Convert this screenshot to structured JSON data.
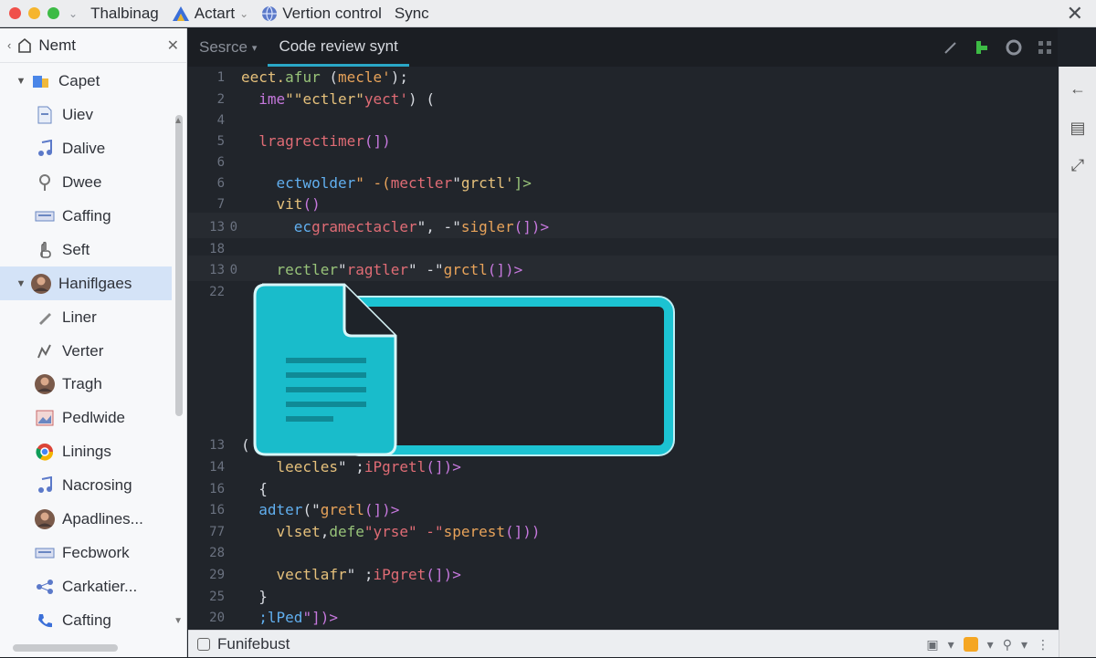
{
  "titlebar": {
    "items": [
      {
        "label": "Thalbinag",
        "icon": "chevron-icon"
      },
      {
        "label": "Actart",
        "icon": "triangle-logo-icon"
      },
      {
        "label": "Vertion control",
        "icon": "globe-icon"
      },
      {
        "label": "Sync",
        "icon": ""
      }
    ]
  },
  "sidebar": {
    "title": "Nemt",
    "items": [
      {
        "label": "Capet",
        "icon": "folder-icon",
        "expanded": true,
        "level": 1
      },
      {
        "label": "Uiev",
        "icon": "document-icon",
        "level": 2
      },
      {
        "label": "Dalive",
        "icon": "music-note-icon",
        "level": 2
      },
      {
        "label": "Dwee",
        "icon": "pin-icon",
        "level": 2
      },
      {
        "label": "Caffing",
        "icon": "keyboard-icon",
        "level": 2
      },
      {
        "label": "Seft",
        "icon": "hand-icon",
        "level": 2
      },
      {
        "label": "Haniflgaes",
        "icon": "avatar-icon",
        "expanded": true,
        "level": 1,
        "selected": true
      },
      {
        "label": "Liner",
        "icon": "pencil-icon",
        "level": 2
      },
      {
        "label": "Verter",
        "icon": "chart-icon",
        "level": 2
      },
      {
        "label": "Tragh",
        "icon": "avatar-icon",
        "level": 2
      },
      {
        "label": "Pedlwide",
        "icon": "image-icon",
        "level": 2
      },
      {
        "label": "Linings",
        "icon": "chrome-icon",
        "level": 2
      },
      {
        "label": "Nacrosing",
        "icon": "music-note-icon",
        "level": 2
      },
      {
        "label": "Apadlines...",
        "icon": "avatar-icon",
        "level": 2
      },
      {
        "label": "Fecbwork",
        "icon": "keyboard-icon",
        "level": 2
      },
      {
        "label": "Carkatier...",
        "icon": "network-icon",
        "level": 2
      },
      {
        "label": "Cafting",
        "icon": "phone-icon",
        "level": 2
      }
    ]
  },
  "editor": {
    "tabs": [
      {
        "label": "Sesrce",
        "active": false,
        "dropdown": true
      },
      {
        "label": "Code review synt",
        "active": true
      }
    ],
    "lines": [
      {
        "num": "1",
        "segments": [
          {
            "t": "eect.",
            "c": "c-yel"
          },
          {
            "t": "afur",
            "c": "c-grn"
          },
          {
            "t": " (",
            "c": "c-wht"
          },
          {
            "t": "mecle'",
            "c": "c-org"
          },
          {
            "t": ");",
            "c": "c-wht"
          }
        ]
      },
      {
        "num": "2",
        "segments": [
          {
            "t": "  ime",
            "c": "c-pur"
          },
          {
            "t": "\"\"ectler\"",
            "c": "c-yel"
          },
          {
            "t": "yect'",
            "c": "c-red"
          },
          {
            "t": ") (",
            "c": "c-wht"
          }
        ]
      },
      {
        "num": "4",
        "segments": []
      },
      {
        "num": "5",
        "segments": [
          {
            "t": "  lragrectimer",
            "c": "c-red"
          },
          {
            "t": "(])",
            "c": "c-pur"
          }
        ]
      },
      {
        "num": "6",
        "segments": []
      },
      {
        "num": "6",
        "segments": [
          {
            "t": "    ectwolder",
            "c": "c-blu"
          },
          {
            "t": "\" -(",
            "c": "c-org"
          },
          {
            "t": "mectler",
            "c": "c-red"
          },
          {
            "t": "\"",
            "c": "c-wht"
          },
          {
            "t": "grctl'",
            "c": "c-yel"
          },
          {
            "t": "]>",
            "c": "c-grn"
          }
        ]
      },
      {
        "num": "7",
        "segments": [
          {
            "t": "    vit",
            "c": "c-yel"
          },
          {
            "t": "()",
            "c": "c-pur"
          }
        ]
      },
      {
        "num": "13",
        "segments": [
          {
            "t": "      ec",
            "c": "c-blu"
          },
          {
            "t": "gramectacler",
            "c": "c-red"
          },
          {
            "t": "\", -\"",
            "c": "c-wht"
          },
          {
            "t": "sigler",
            "c": "c-org"
          },
          {
            "t": "(])>",
            "c": "c-pur"
          }
        ]
      },
      {
        "num": "18",
        "segments": []
      },
      {
        "num": "13",
        "segments": [
          {
            "t": "    rectler",
            "c": "c-grn"
          },
          {
            "t": "\"",
            "c": "c-wht"
          },
          {
            "t": "ragtler",
            "c": "c-red"
          },
          {
            "t": "\" -\"",
            "c": "c-wht"
          },
          {
            "t": "grctl",
            "c": "c-org"
          },
          {
            "t": "(])>",
            "c": "c-pur"
          }
        ]
      },
      {
        "num": "22",
        "segments": []
      },
      {
        "num": "13",
        "segments": [
          {
            "t": "(",
            "c": "c-wht"
          }
        ]
      },
      {
        "num": "14",
        "segments": [
          {
            "t": "    leecles",
            "c": "c-yel"
          },
          {
            "t": "\" ;",
            "c": "c-wht"
          },
          {
            "t": "iPgretl",
            "c": "c-red"
          },
          {
            "t": "(])>",
            "c": "c-pur"
          }
        ]
      },
      {
        "num": "16",
        "segments": [
          {
            "t": "  {",
            "c": "c-wht"
          }
        ]
      },
      {
        "num": "16",
        "segments": [
          {
            "t": "  adter",
            "c": "c-blu"
          },
          {
            "t": "(\"",
            "c": "c-wht"
          },
          {
            "t": "gretl",
            "c": "c-org"
          },
          {
            "t": "(])>",
            "c": "c-pur"
          }
        ]
      },
      {
        "num": "77",
        "segments": [
          {
            "t": "    vlset",
            "c": "c-yel"
          },
          {
            "t": ",",
            "c": "c-wht"
          },
          {
            "t": "defe",
            "c": "c-grn"
          },
          {
            "t": "\"yrse\" -\"",
            "c": "c-red"
          },
          {
            "t": "sperest",
            "c": "c-org"
          },
          {
            "t": "(]))",
            "c": "c-pur"
          }
        ]
      },
      {
        "num": "28",
        "segments": []
      },
      {
        "num": "29",
        "segments": [
          {
            "t": "    vectlafr",
            "c": "c-yel"
          },
          {
            "t": "\" ;",
            "c": "c-wht"
          },
          {
            "t": "iPgret",
            "c": "c-red"
          },
          {
            "t": "(])>",
            "c": "c-pur"
          }
        ]
      },
      {
        "num": "25",
        "segments": [
          {
            "t": "  }",
            "c": "c-wht"
          }
        ]
      },
      {
        "num": "20",
        "segments": [
          {
            "t": "  ;lPed",
            "c": "c-blu"
          },
          {
            "t": "\"])>",
            "c": "c-pur"
          }
        ]
      }
    ],
    "fold_markers": [
      "0",
      "0"
    ]
  },
  "statusbar": {
    "label": "Funifebust"
  },
  "colors": {
    "accent": "#1cc3d2",
    "editor_bg": "#21252b",
    "sidebar_selected": "#d4e3f7"
  }
}
